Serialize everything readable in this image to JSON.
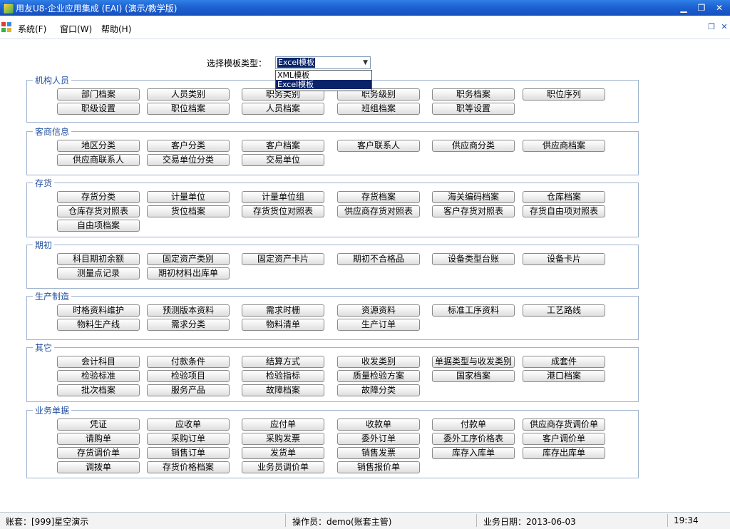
{
  "window": {
    "title": "用友U8-企业应用集成 (EAI) (演示/教学版)"
  },
  "menu": {
    "items": [
      "系统(F)",
      "窗口(W)",
      "帮助(H)"
    ]
  },
  "template": {
    "label": "选择模板类型：",
    "selected": "Excel模板",
    "options": [
      "XML模板",
      "Excel模板"
    ]
  },
  "groups": [
    {
      "title": "机构人员",
      "buttons": [
        "部门档案",
        "人员类别",
        "职务类别",
        "职务级别",
        "职务档案",
        "职位序列",
        "职级设置",
        "职位档案",
        "人员档案",
        "班组档案",
        "职等设置"
      ]
    },
    {
      "title": "客商信息",
      "buttons": [
        "地区分类",
        "客户分类",
        "客户档案",
        "客户联系人",
        "供应商分类",
        "供应商档案",
        "供应商联系人",
        "交易单位分类",
        "交易单位"
      ]
    },
    {
      "title": "存货",
      "buttons": [
        "存货分类",
        "计量单位",
        "计量单位组",
        "存货档案",
        "海关编码档案",
        "仓库档案",
        "仓库存货对照表",
        "货位档案",
        "存货货位对照表",
        "供应商存货对照表",
        "客户存货对照表",
        "存货自由项对照表",
        "自由项档案"
      ]
    },
    {
      "title": "期初",
      "buttons": [
        "科目期初余额",
        "固定资产类别",
        "固定资产卡片",
        "期初不合格品",
        "设备类型台账",
        "设备卡片",
        "测量点记录",
        "期初材料出库单"
      ]
    },
    {
      "title": "生产制造",
      "buttons": [
        "时格资料维护",
        "预测版本资料",
        "需求时栅",
        "资源资料",
        "标准工序资料",
        "工艺路线",
        "物料生产线",
        "需求分类",
        "物料清单",
        "生产订单"
      ]
    },
    {
      "title": "其它",
      "buttons": [
        "会计科目",
        "付款条件",
        "结算方式",
        "收发类别",
        "单据类型与收发类别",
        "成套件",
        "检验标准",
        "检验项目",
        "检验指标",
        "质量检验方案",
        "国家档案",
        "港口档案",
        "批次档案",
        "服务产品",
        "故障档案",
        "故障分类"
      ]
    },
    {
      "title": "业务单据",
      "buttons": [
        "凭证",
        "应收单",
        "应付单",
        "收款单",
        "付款单",
        "供应商存货调价单",
        "请购单",
        "采购订单",
        "采购发票",
        "委外订单",
        "委外工序价格表",
        "客户调价单",
        "存货调价单",
        "销售订单",
        "发货单",
        "销售发票",
        "库存入库单",
        "库存出库单",
        "调拨单",
        "存货价格档案",
        "业务员调价单",
        "销售报价单"
      ]
    }
  ],
  "status": {
    "account": "账套：[999]星空演示",
    "operator": "操作员：demo(账套主管)",
    "date": "业务日期：2013-06-03",
    "time": "19:34"
  }
}
